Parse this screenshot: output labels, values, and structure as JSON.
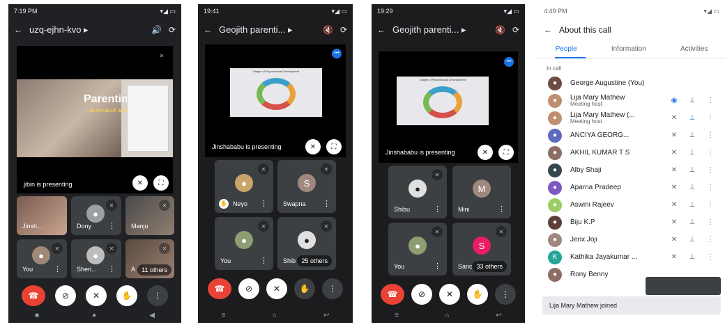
{
  "phone1": {
    "status_time": "7:19 PM",
    "meeting_code": "uzq-ejhn-kvo",
    "slide_title": "Parenting",
    "slide_subtitle": "മാതാക്കൾ യുതം",
    "presenting": "jibin is presenting",
    "tiles": [
      {
        "name": "Jinsh..."
      },
      {
        "name": "Dony"
      },
      {
        "name": "Manju"
      },
      {
        "name": "You"
      },
      {
        "name": "Sheri..."
      },
      {
        "name": "A"
      }
    ],
    "others": "11 others"
  },
  "phone2": {
    "status_time": "19:41",
    "meeting_title": "Geojith parenti...",
    "presenting": "Jinshababu is presenting",
    "slide_heading": "Stages of Psychosocial Development",
    "tiles": [
      {
        "name": "Neyo"
      },
      {
        "name": "Swapna",
        "initial": "S"
      },
      {
        "name": "You"
      },
      {
        "name": "Shib"
      }
    ],
    "others": "25 others"
  },
  "phone3": {
    "status_time": "19:29",
    "meeting_title": "Geojith parenti...",
    "presenting": "Jinshababu is presenting",
    "slide_heading": "Stages of Psychosocial Development",
    "tiles": [
      {
        "name": "Shibu"
      },
      {
        "name": "Mini",
        "initial": "M"
      },
      {
        "name": "You"
      },
      {
        "name": "Sanc",
        "initial": "S"
      }
    ],
    "others": "33 others"
  },
  "phone4": {
    "status_time": "4:49 PM",
    "header_title": "About this call",
    "tabs": [
      "People",
      "Information",
      "Activities"
    ],
    "section_label": "In call",
    "participants": [
      {
        "name": "George Augustine (You)",
        "sub": ""
      },
      {
        "name": "Lija Mary Mathew",
        "sub": "Meeting host"
      },
      {
        "name": "Lija Mary Mathew (...",
        "sub": "Meeting host"
      },
      {
        "name": "ANCIYA GEORG...",
        "sub": ""
      },
      {
        "name": "AKHIL KUMAR T S",
        "sub": ""
      },
      {
        "name": "Alby Shaji",
        "sub": ""
      },
      {
        "name": "Aparna Pradeep",
        "sub": ""
      },
      {
        "name": "Aswini Rajeev",
        "sub": ""
      },
      {
        "name": "Biju K.P",
        "sub": ""
      },
      {
        "name": "Jerix Joji",
        "sub": ""
      },
      {
        "name": "Kathika Jayakumar ...",
        "sub": ""
      },
      {
        "name": "Rony Benny",
        "sub": ""
      }
    ],
    "toast": "Lija Mary Mathew joined"
  },
  "colors": {
    "end_call": "#ea4335",
    "accent_blue": "#1a73e8",
    "dark_bg": "#202124",
    "tile_bg": "#3c4043"
  }
}
